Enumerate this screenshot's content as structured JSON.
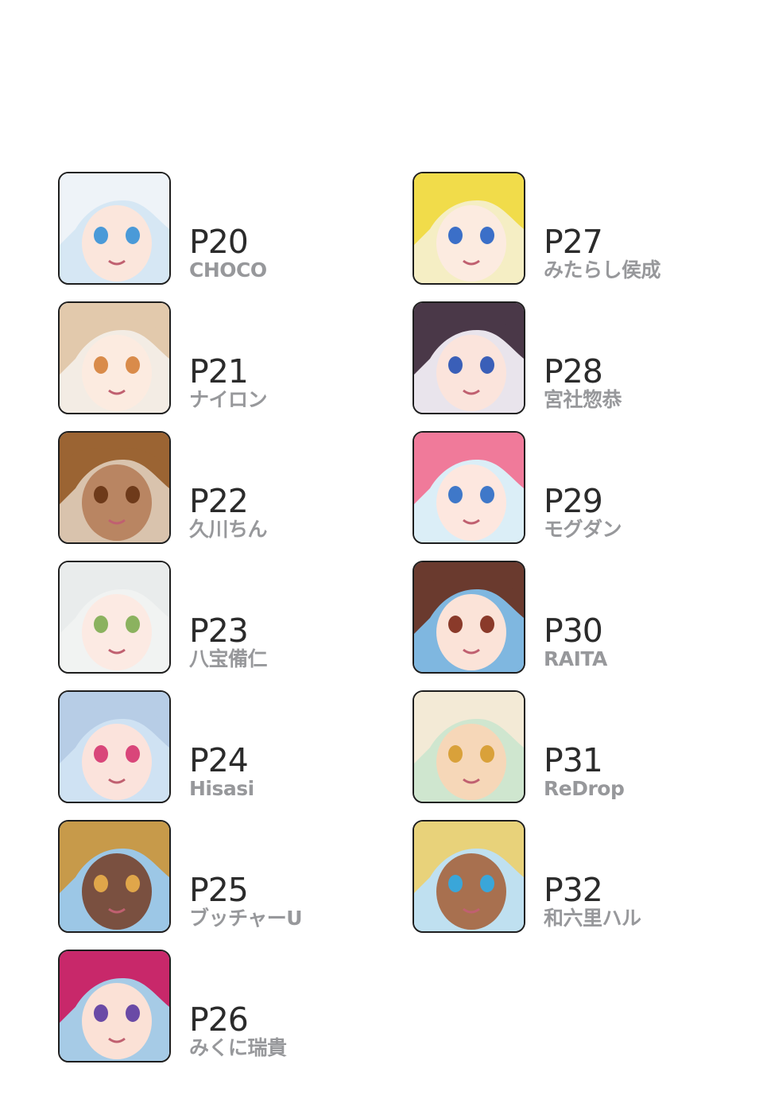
{
  "contributors": {
    "left": [
      {
        "page": "P20",
        "artist": "CHOCO",
        "colors": {
          "bg": "#d6e7f4",
          "hair": "#eef3f8",
          "skin": "#fbe6dc",
          "eye": "#4a9ad8"
        }
      },
      {
        "page": "P21",
        "artist": "ナイロン",
        "colors": {
          "bg": "#f3ece4",
          "hair": "#e2c9ac",
          "skin": "#fcebe0",
          "eye": "#d98b4a"
        }
      },
      {
        "page": "P22",
        "artist": "久川ちん",
        "colors": {
          "bg": "#d9c3ad",
          "hair": "#9b6433",
          "skin": "#b98562",
          "eye": "#6e3a1a"
        }
      },
      {
        "page": "P23",
        "artist": "八宝備仁",
        "colors": {
          "bg": "#f1f3f2",
          "hair": "#e9ecec",
          "skin": "#fceae3",
          "eye": "#8bb25f"
        }
      },
      {
        "page": "P24",
        "artist": "Hisasi",
        "colors": {
          "bg": "#cfe2f3",
          "hair": "#b7cde6",
          "skin": "#fbe3dc",
          "eye": "#d9467a"
        }
      },
      {
        "page": "P25",
        "artist": "ブッチャーU",
        "colors": {
          "bg": "#9cc7e6",
          "hair": "#c79a4a",
          "skin": "#7a5040",
          "eye": "#e0a64a"
        }
      },
      {
        "page": "P26",
        "artist": "みくに瑞貴",
        "colors": {
          "bg": "#a6cbe6",
          "hair": "#c8286a",
          "skin": "#fbe1d6",
          "eye": "#6a4aa6"
        }
      }
    ],
    "right": [
      {
        "page": "P27",
        "artist": "みたらし侯成",
        "colors": {
          "bg": "#f5eec4",
          "hair": "#f1dc4a",
          "skin": "#fcebe0",
          "eye": "#3b6fc8"
        }
      },
      {
        "page": "P28",
        "artist": "宮社惣恭",
        "colors": {
          "bg": "#e9e4ec",
          "hair": "#4a3848",
          "skin": "#fbe4dc",
          "eye": "#3a5fb8"
        }
      },
      {
        "page": "P29",
        "artist": "モグダン",
        "colors": {
          "bg": "#dbeef7",
          "hair": "#f07a9a",
          "skin": "#fde7df",
          "eye": "#3f78c9"
        }
      },
      {
        "page": "P30",
        "artist": "RAITA",
        "colors": {
          "bg": "#7fb7e0",
          "hair": "#6a3a2e",
          "skin": "#fbe3d8",
          "eye": "#8a3a2a"
        }
      },
      {
        "page": "P31",
        "artist": "ReDrop",
        "colors": {
          "bg": "#cfe6cf",
          "hair": "#f3ead6",
          "skin": "#f6d7b8",
          "eye": "#d9a13a"
        }
      },
      {
        "page": "P32",
        "artist": "和六里ハル",
        "colors": {
          "bg": "#bfe0f0",
          "hair": "#e8d27a",
          "skin": "#a8704f",
          "eye": "#3aa6d9"
        }
      }
    ]
  }
}
